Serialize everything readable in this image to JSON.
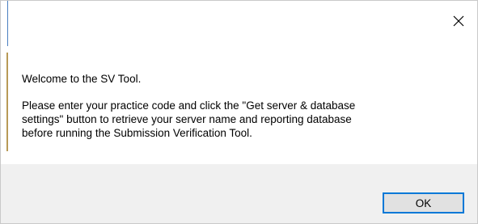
{
  "dialog": {
    "close_icon": "close-icon",
    "welcome_text": "Welcome to the SV Tool.",
    "message_lines": [
      "Please enter your practice code and click the \"Get server & database",
      "settings\" button to retrieve your server name and reporting database",
      "before running the Submission Verification Tool."
    ],
    "ok_label": "OK"
  },
  "colors": {
    "accent": "#0078d7",
    "footer_bg": "#f0f0f0",
    "button_bg": "#e1e1e1"
  }
}
